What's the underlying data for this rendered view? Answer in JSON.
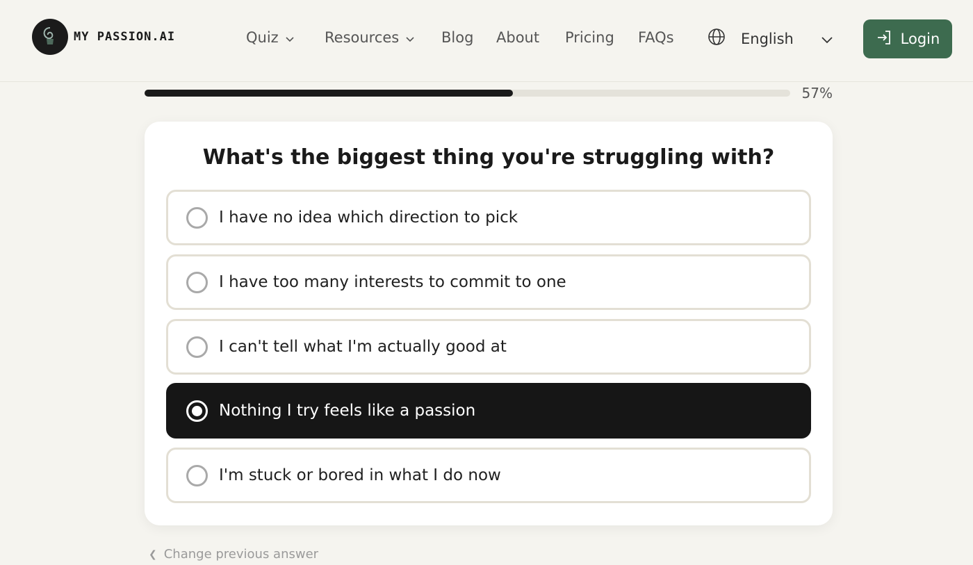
{
  "header": {
    "logo_text": "MY PASSION.AI",
    "nav": [
      {
        "label": "Quiz",
        "dropdown": true
      },
      {
        "label": "Resources",
        "dropdown": true
      },
      {
        "label": "Blog",
        "dropdown": false
      },
      {
        "label": "About",
        "dropdown": false
      },
      {
        "label": "Pricing",
        "dropdown": false
      },
      {
        "label": "FAQs",
        "dropdown": false
      }
    ],
    "language": "English",
    "login_label": "Login"
  },
  "progress": {
    "percent": 57,
    "label": "57%"
  },
  "quiz": {
    "question": "What's the biggest thing you're struggling with?",
    "options": [
      {
        "label": "I have no idea which direction to pick",
        "selected": false
      },
      {
        "label": "I have too many interests to commit to one",
        "selected": false
      },
      {
        "label": "I can't tell what I'm actually good at",
        "selected": false
      },
      {
        "label": "Nothing I try feels like a passion",
        "selected": true
      },
      {
        "label": "I'm stuck or bored in what I do now",
        "selected": false
      }
    ],
    "back_label": "Change previous answer"
  },
  "colors": {
    "accent": "#3d6b4f",
    "selected_bg": "#161616",
    "background": "#f5f4ef"
  },
  "icons": [
    "logo-icon",
    "chevron-down-icon",
    "globe-icon",
    "login-icon",
    "radio-icon",
    "chevron-left-icon"
  ]
}
